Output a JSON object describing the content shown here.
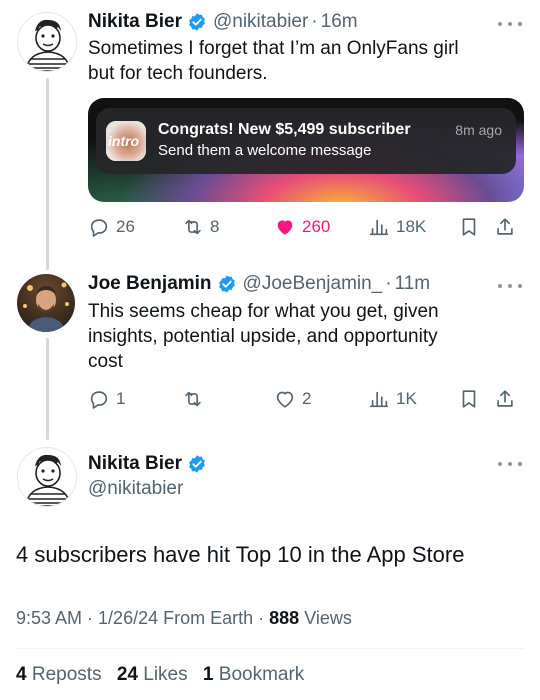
{
  "tweet1": {
    "name": "Nikita Bier",
    "handle": "@nikitabier",
    "time": "16m",
    "text_line1": "Sometimes I forget that I’m an OnlyFans girl",
    "text_line2": "but for tech founders.",
    "notification": {
      "app_label": "intro",
      "title": "Congrats! New $5,499 subscriber",
      "subtitle": "Send them a welcome message",
      "time": "8m ago"
    },
    "replies": "26",
    "reposts": "8",
    "likes": "260",
    "views": "18K"
  },
  "tweet2": {
    "name": "Joe Benjamin",
    "handle": "@JoeBenjamin_",
    "time": "11m",
    "text_line1": "This seems cheap for what you get, given",
    "text_line2": "insights, potential upside, and opportunity",
    "text_line3": "cost",
    "replies": "1",
    "reposts": "",
    "likes": "2",
    "views": "1K"
  },
  "main_tweet": {
    "name": "Nikita Bier",
    "handle": "@nikitabier",
    "text": "4 subscribers have hit Top 10 in the App Store",
    "time": "9:53 AM",
    "date": "1/26/24",
    "source": "From Earth",
    "views_count": "888",
    "views_label": "Views",
    "reposts_count": "4",
    "reposts_label": "Reposts",
    "likes_count": "24",
    "likes_label": "Likes",
    "bookmarks_count": "1",
    "bookmarks_label": "Bookmark"
  },
  "colors": {
    "accent": "#1d9bf0",
    "like": "#f91880",
    "muted": "#536471"
  }
}
